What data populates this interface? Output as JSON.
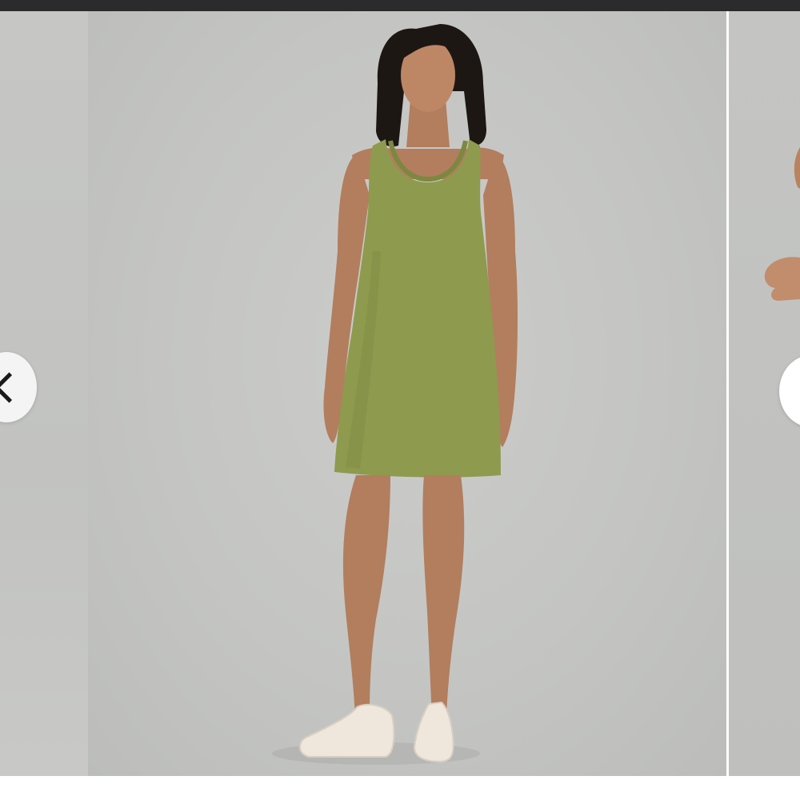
{
  "window": {
    "top_bar_color": "#2b2b2b",
    "background_color": "#c6c7c5"
  },
  "carousel": {
    "prev_button": {
      "icon": "chevron-left-icon"
    },
    "next_button": {
      "icon": "chevron-right-icon"
    },
    "main_image": {
      "subject": "tank-dress",
      "dress_color": "#8e9a4e",
      "shoe_color": "#efe7db"
    }
  }
}
